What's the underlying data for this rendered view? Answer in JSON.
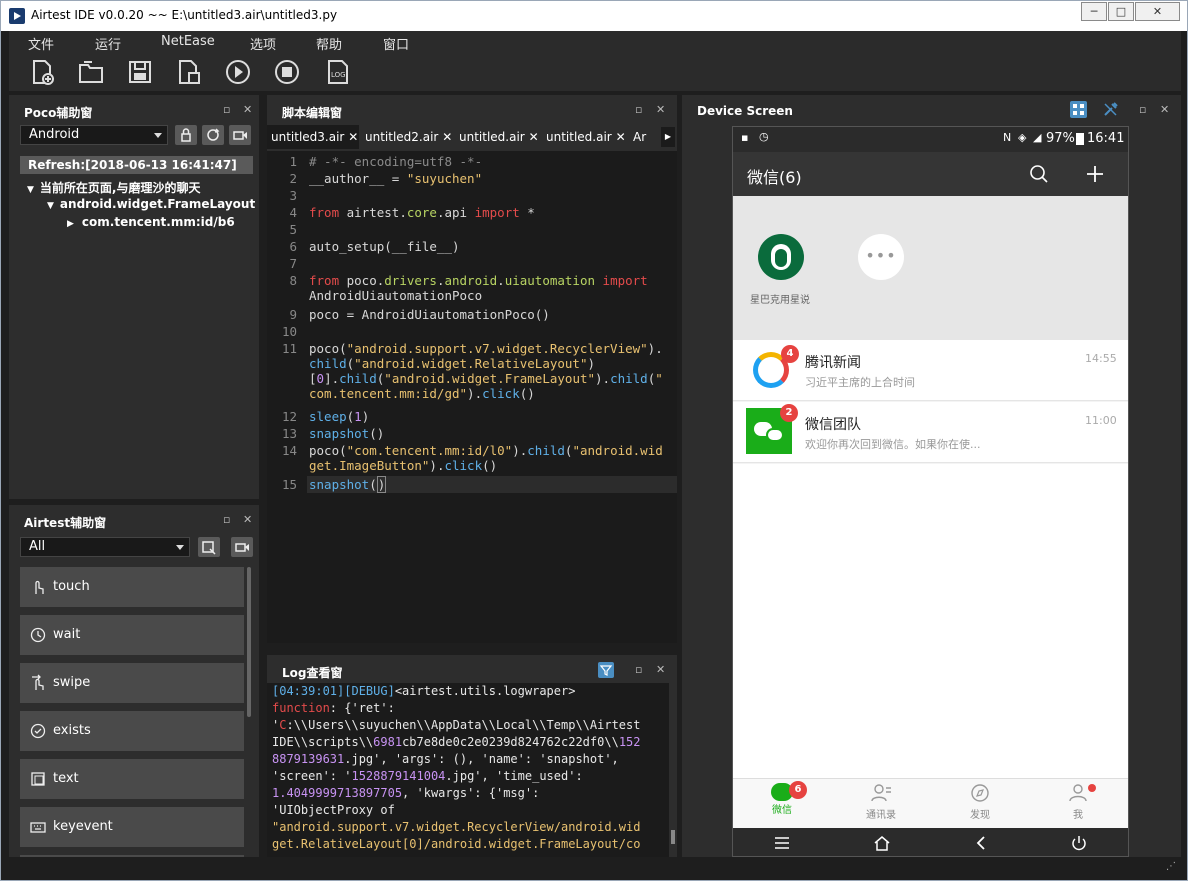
{
  "window": {
    "title": "Airtest IDE v0.0.20 ~~ E:\\untitled3.air\\untitled3.py",
    "minimize": "─",
    "maximize": "□",
    "close": "✕"
  },
  "menu": [
    "文件",
    "运行",
    "NetEase",
    "选项",
    "帮助",
    "窗口"
  ],
  "toolbar": {
    "log_label": "LOG"
  },
  "poco": {
    "title": "Poco辅助窗",
    "platform": "Android",
    "refresh": "Refresh:[2018-06-13 16:41:47]",
    "tree": [
      "当前所在页面,与磨理沙的聊天",
      "android.widget.FrameLayout",
      "com.tencent.mm:id/b6"
    ]
  },
  "airtest": {
    "title": "Airtest辅助窗",
    "filter": "All",
    "buttons": [
      "touch",
      "wait",
      "swipe",
      "exists",
      "text",
      "keyevent"
    ]
  },
  "editor": {
    "title": "脚本编辑窗",
    "tabs": [
      "untitled3.air",
      "untitled2.air",
      "untitled.air",
      "untitled.air",
      "Ar"
    ]
  },
  "log": {
    "title": "Log查看窗"
  },
  "device": {
    "title": "Device Screen",
    "status": {
      "battery": "97%",
      "time": "16:41"
    },
    "wechat_title": "微信(6)",
    "top_card_label": "星巴克用星说",
    "chats": [
      {
        "name": "腾讯新闻",
        "preview": "习近平主席的上合时间",
        "time": "14:55",
        "badge": "4"
      },
      {
        "name": "微信团队",
        "preview": "欢迎你再次回到微信。如果你在使...",
        "time": "11:00",
        "badge": "2"
      }
    ],
    "nav": [
      {
        "label": "微信",
        "badge": "6"
      },
      {
        "label": "通讯录"
      },
      {
        "label": "发现"
      },
      {
        "label": "我"
      }
    ]
  },
  "colors": {
    "accent_green": "#1aad19",
    "badge_red": "#e64340",
    "panel": "#2d2d2d",
    "editor_bg": "#1b1b1b"
  }
}
